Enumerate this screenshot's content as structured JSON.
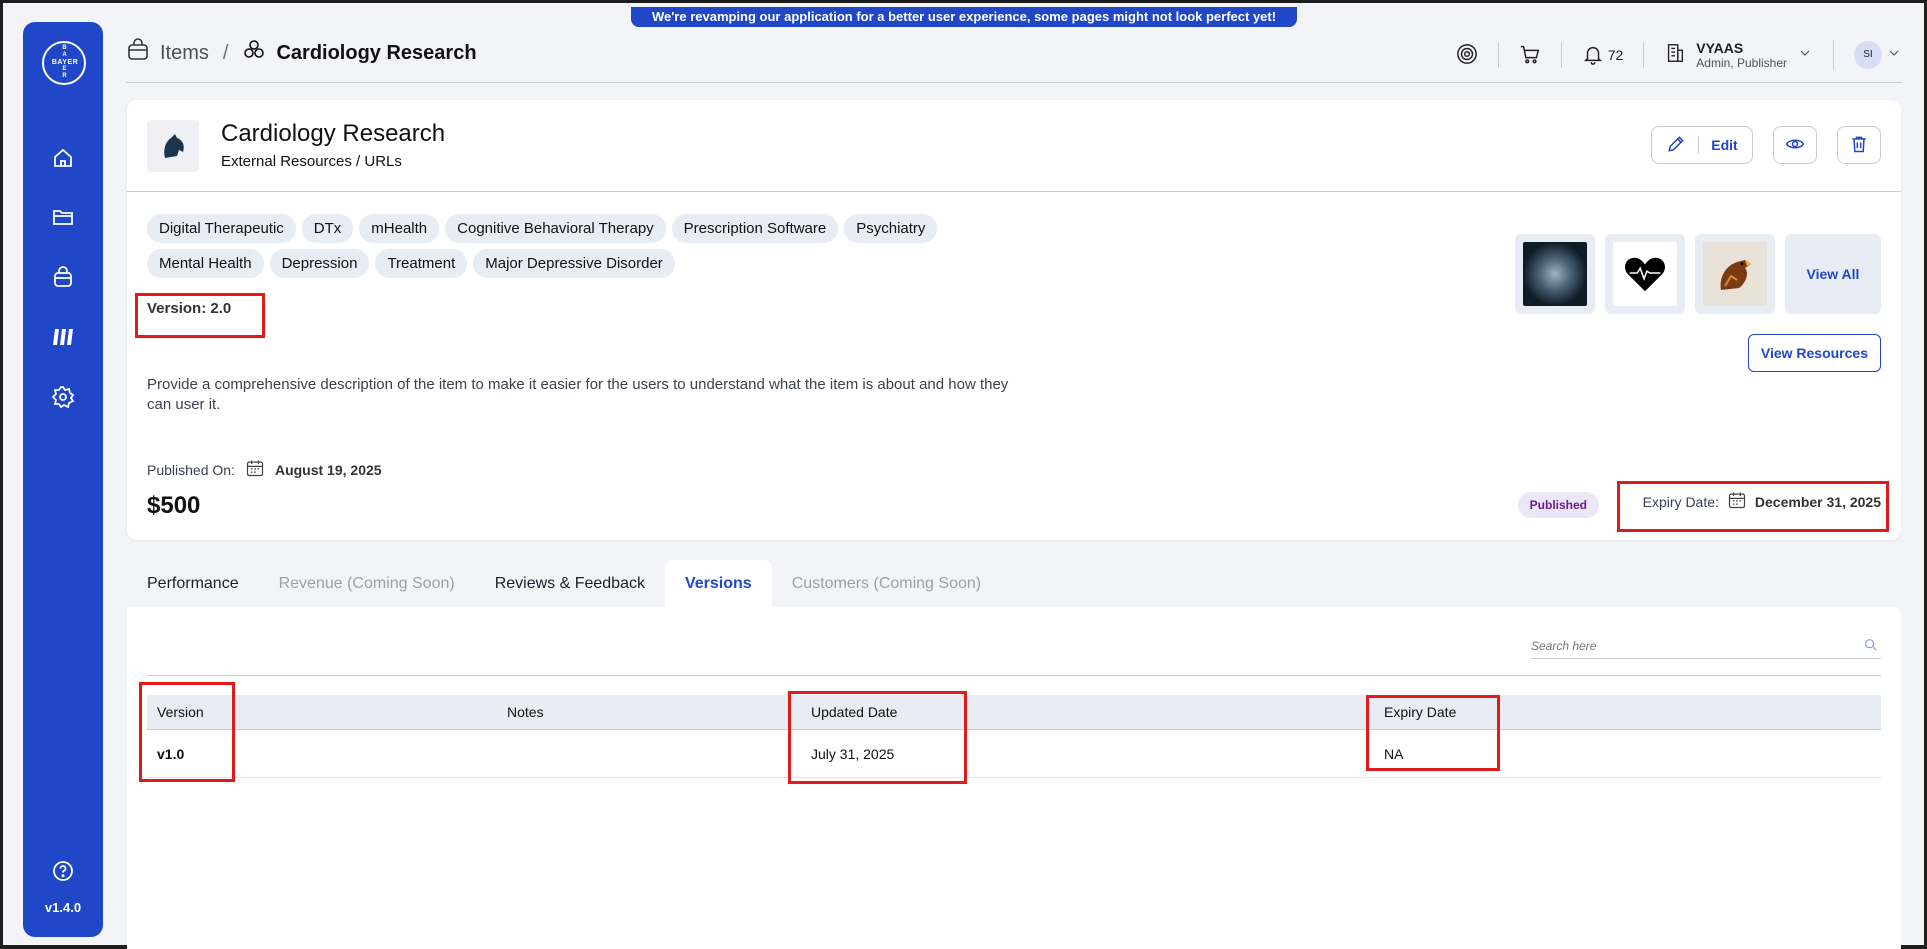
{
  "banner": "We're revamping our application for a better user experience, some pages might not look perfect yet!",
  "sidebar": {
    "logo_vertical": "BAYER",
    "logo_horizontal": "BAYER",
    "items": [
      "home-icon",
      "folder-icon",
      "bag-icon",
      "library-icon",
      "settings-icon"
    ],
    "help_icon": "help-icon",
    "version": "v1.4.0"
  },
  "header": {
    "breadcrumb_root": "Items",
    "breadcrumb_separator": "/",
    "breadcrumb_current": "Cardiology Research",
    "notifications_count": "72",
    "user_name": "VYAAS",
    "user_role": "Admin, Publisher",
    "avatar_initials": "SI"
  },
  "item": {
    "title": "Cardiology Research",
    "subtitle": "External Resources / URLs",
    "edit_label": "Edit",
    "tags": [
      "Digital Therapeutic",
      "DTx",
      "mHealth",
      "Cognitive Behavioral Therapy",
      "Prescription Software",
      "Psychiatry",
      "Mental Health",
      "Depression",
      "Treatment",
      "Major Depressive Disorder"
    ],
    "version": "Version: 2.0",
    "description": "Provide a comprehensive description of the item to make it easier for the users to understand what the item is about and how they can user it.",
    "published_label": "Published On:",
    "published_date": "August 19, 2025",
    "price": "$500",
    "view_all": "View All",
    "view_resources": "View Resources",
    "status": "Published",
    "expiry_label": "Expiry Date:",
    "expiry_date": "December 31, 2025"
  },
  "tabs": [
    {
      "label": "Performance",
      "state": "normal"
    },
    {
      "label": "Revenue (Coming Soon)",
      "state": "disabled"
    },
    {
      "label": "Reviews & Feedback",
      "state": "normal"
    },
    {
      "label": "Versions",
      "state": "active"
    },
    {
      "label": "Customers (Coming Soon)",
      "state": "disabled"
    }
  ],
  "versions": {
    "search_placeholder": "Search here",
    "columns": [
      "Version",
      "Notes",
      "Updated Date",
      "Expiry Date"
    ],
    "rows": [
      {
        "version": "v1.0",
        "notes": "",
        "updated": "July 31, 2025",
        "expiry": "NA"
      }
    ]
  },
  "colors": {
    "accent": "#1f47c8",
    "highlight": "#e01b1b",
    "status": "#6a1f8f"
  }
}
